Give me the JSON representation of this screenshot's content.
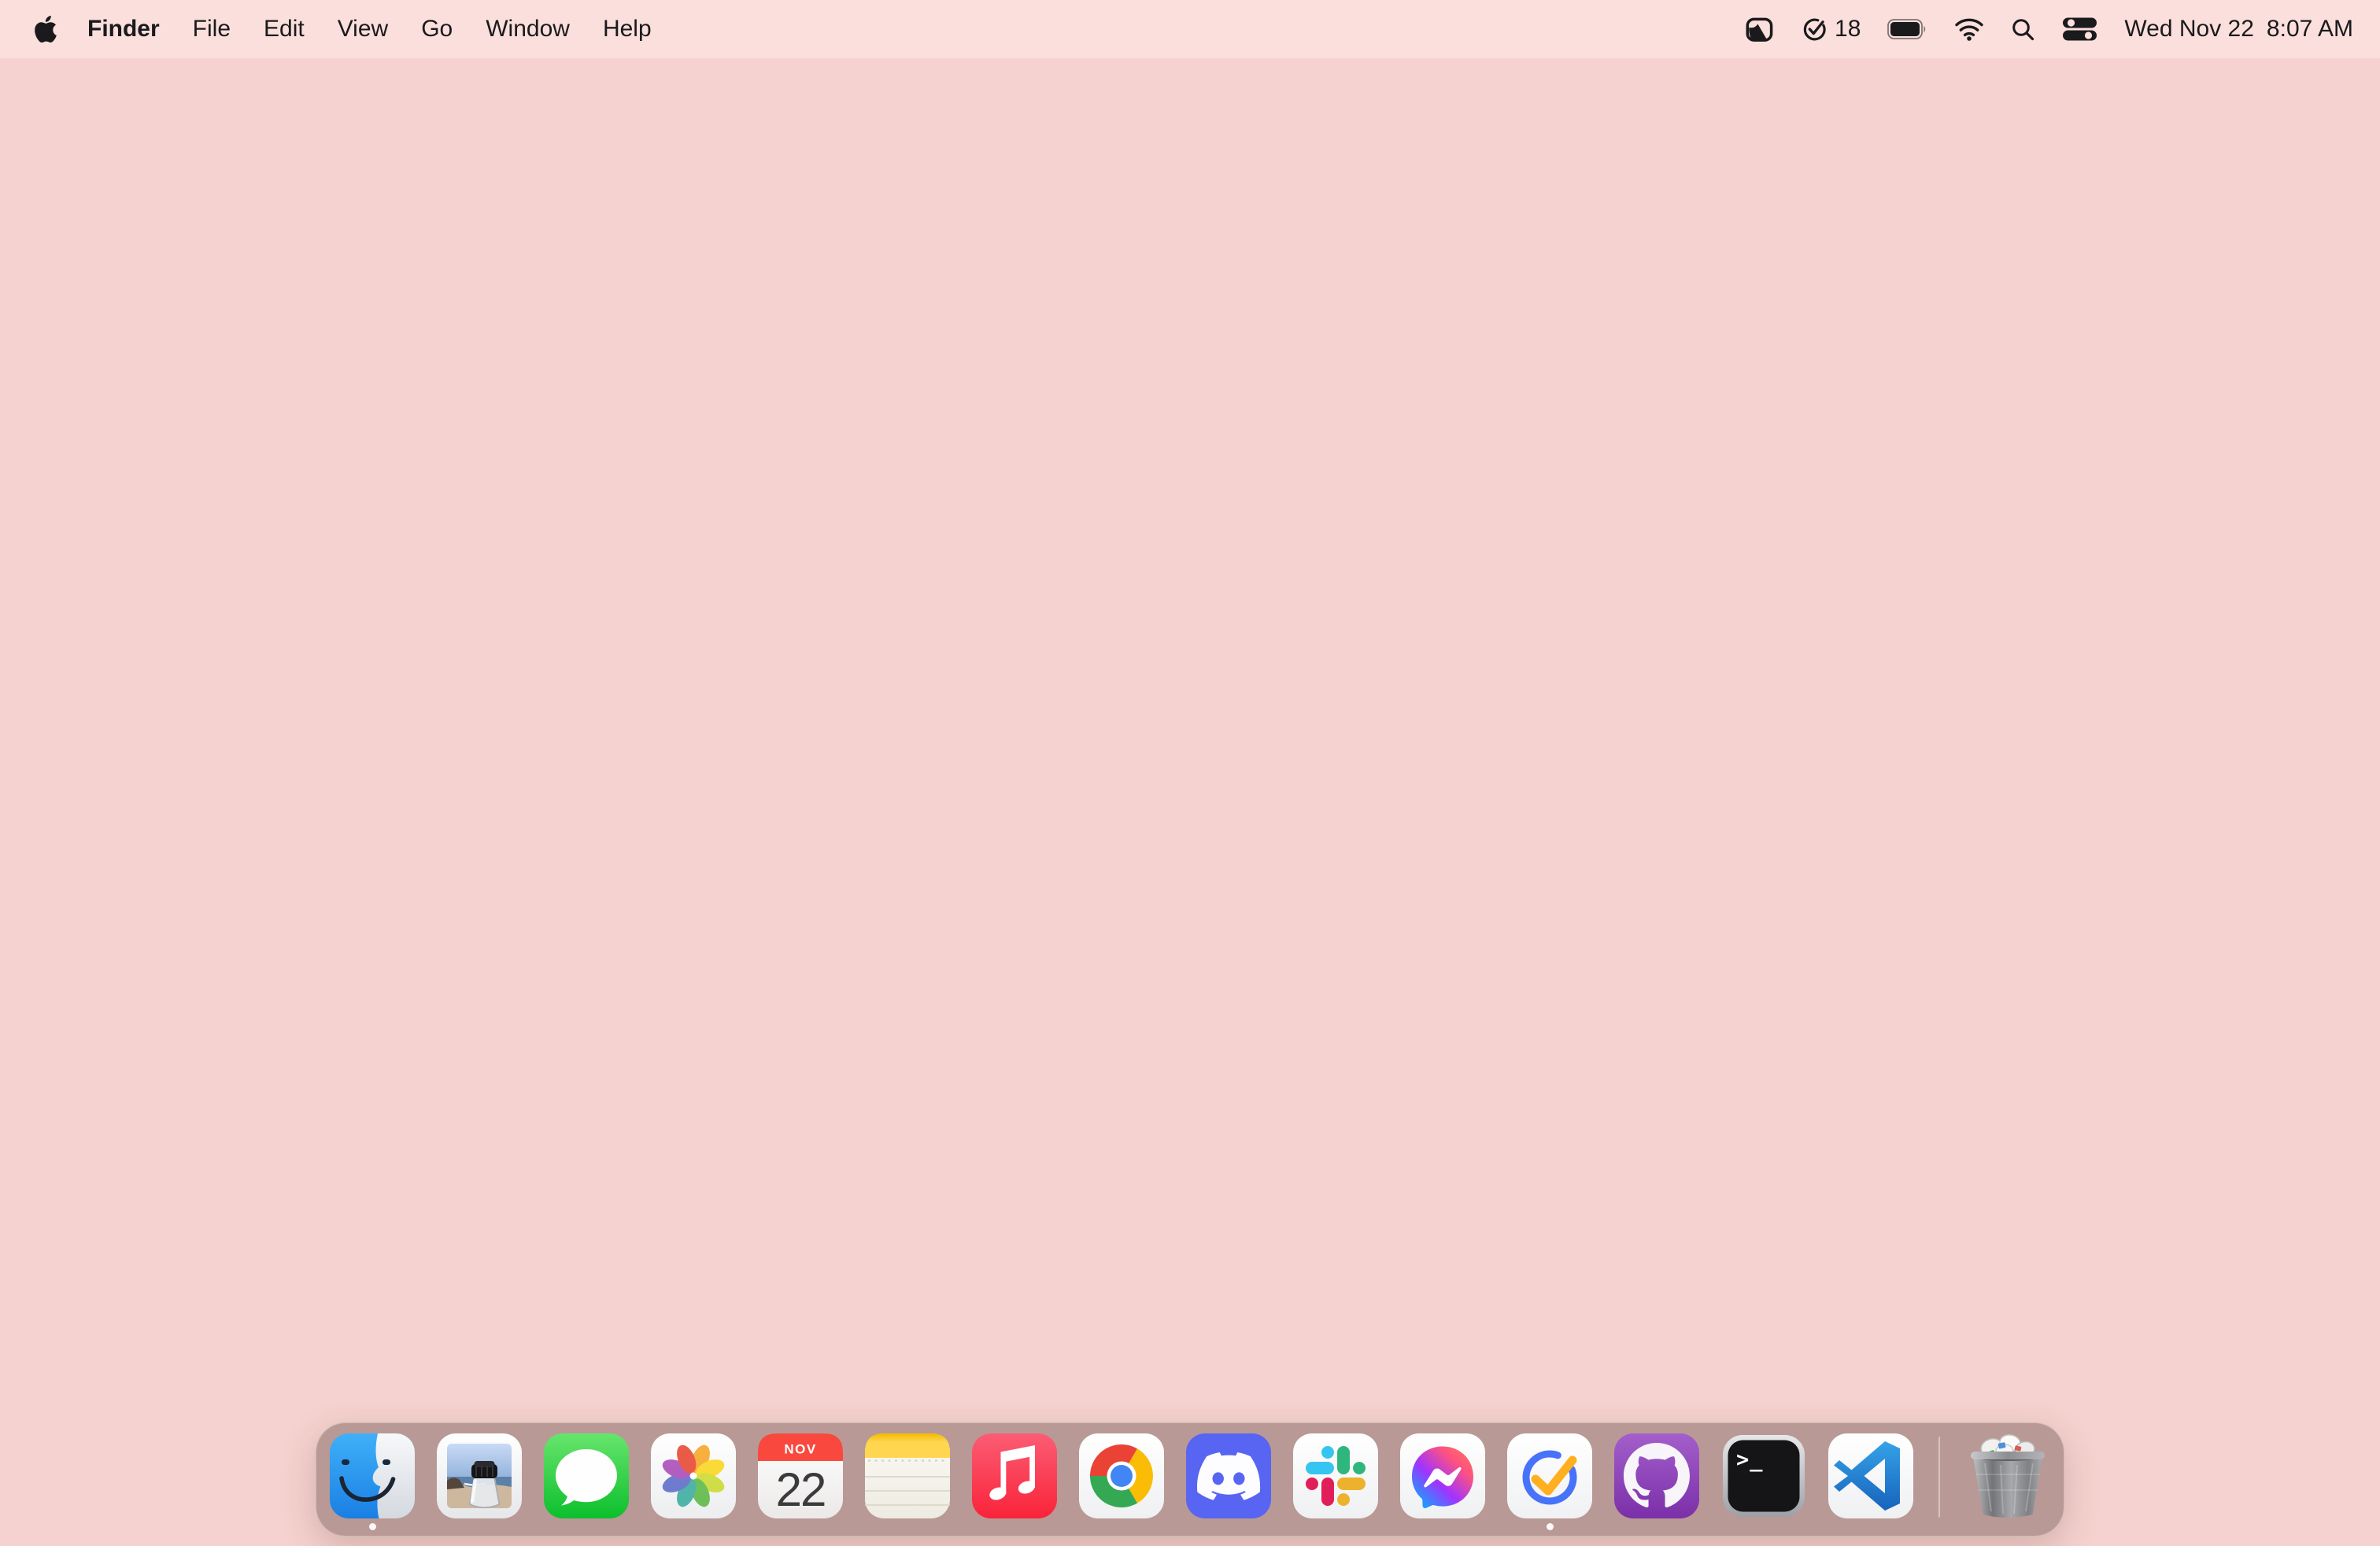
{
  "menu_bar": {
    "app_name": "Finder",
    "menus": [
      "File",
      "Edit",
      "View",
      "Go",
      "Window",
      "Help"
    ],
    "status": {
      "task_count": "18",
      "date": "Wed Nov 22",
      "time": "8:07 AM"
    }
  },
  "dock": {
    "calendar": {
      "month": "NOV",
      "day": "22"
    },
    "terminal_prompt": ">_",
    "apps": [
      "Finder",
      "Preview",
      "Messages",
      "Photos",
      "Calendar",
      "Notes",
      "Music",
      "Google Chrome",
      "Discord",
      "Slack",
      "Messenger",
      "TickTick",
      "GitHub Desktop",
      "Terminal",
      "Visual Studio Code",
      "Trash"
    ],
    "running_apps": [
      "Finder",
      "TickTick"
    ],
    "trash_state": "full"
  },
  "colors": {
    "desktop": "#F5D2CF",
    "menu_bar": "#FBDFDC",
    "dock_overlay": "rgba(131,101,96,0.52)",
    "ticktick_blue": "#4772FA",
    "ticktick_orange": "#FFAF1F",
    "discord_blurple": "#5865F2"
  }
}
